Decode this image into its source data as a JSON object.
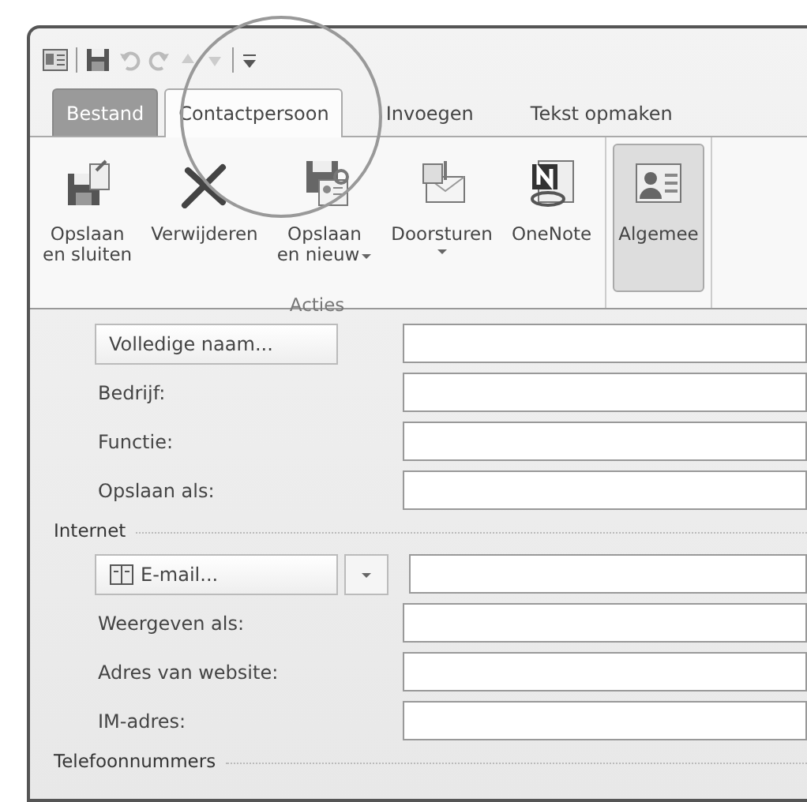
{
  "tabs": [
    {
      "label": "Bestand",
      "kind": "file",
      "selected": false
    },
    {
      "label": "Contactpersoon",
      "kind": "tab",
      "selected": true
    },
    {
      "label": "Invoegen",
      "kind": "tab",
      "selected": false
    },
    {
      "label": "Tekst opmaken",
      "kind": "tab",
      "selected": false
    }
  ],
  "ribbon": {
    "groups": [
      {
        "label": "Acties",
        "buttons": [
          {
            "lines": [
              "Opslaan",
              "en sluiten"
            ],
            "dropdown": false,
            "selected": false
          },
          {
            "lines": [
              "Verwijderen"
            ],
            "dropdown": false,
            "selected": false
          },
          {
            "lines": [
              "Opslaan",
              "en nieuw"
            ],
            "dropdown": true,
            "selected": false
          },
          {
            "lines": [
              "Doorsturen"
            ],
            "dropdown": true,
            "selected": false
          },
          {
            "lines": [
              "OneNote"
            ],
            "dropdown": false,
            "selected": false
          }
        ]
      },
      {
        "buttons": [
          {
            "lines": [
              "Algemee"
            ],
            "dropdown": false,
            "selected": true
          }
        ]
      }
    ]
  },
  "form": [
    {
      "kind": "button",
      "label": "Volledige naam..."
    },
    {
      "kind": "label",
      "label": "Bedrijf:"
    },
    {
      "kind": "label",
      "label": "Functie:"
    },
    {
      "kind": "label",
      "label": "Opslaan als:"
    },
    {
      "kind": "section",
      "label": "Internet"
    },
    {
      "kind": "email",
      "label": "E-mail..."
    },
    {
      "kind": "label",
      "label": "Weergeven als:"
    },
    {
      "kind": "label",
      "label": "Adres van website:"
    },
    {
      "kind": "label",
      "label": "IM-adres:"
    },
    {
      "kind": "section",
      "label": "Telefoonnummers"
    }
  ]
}
